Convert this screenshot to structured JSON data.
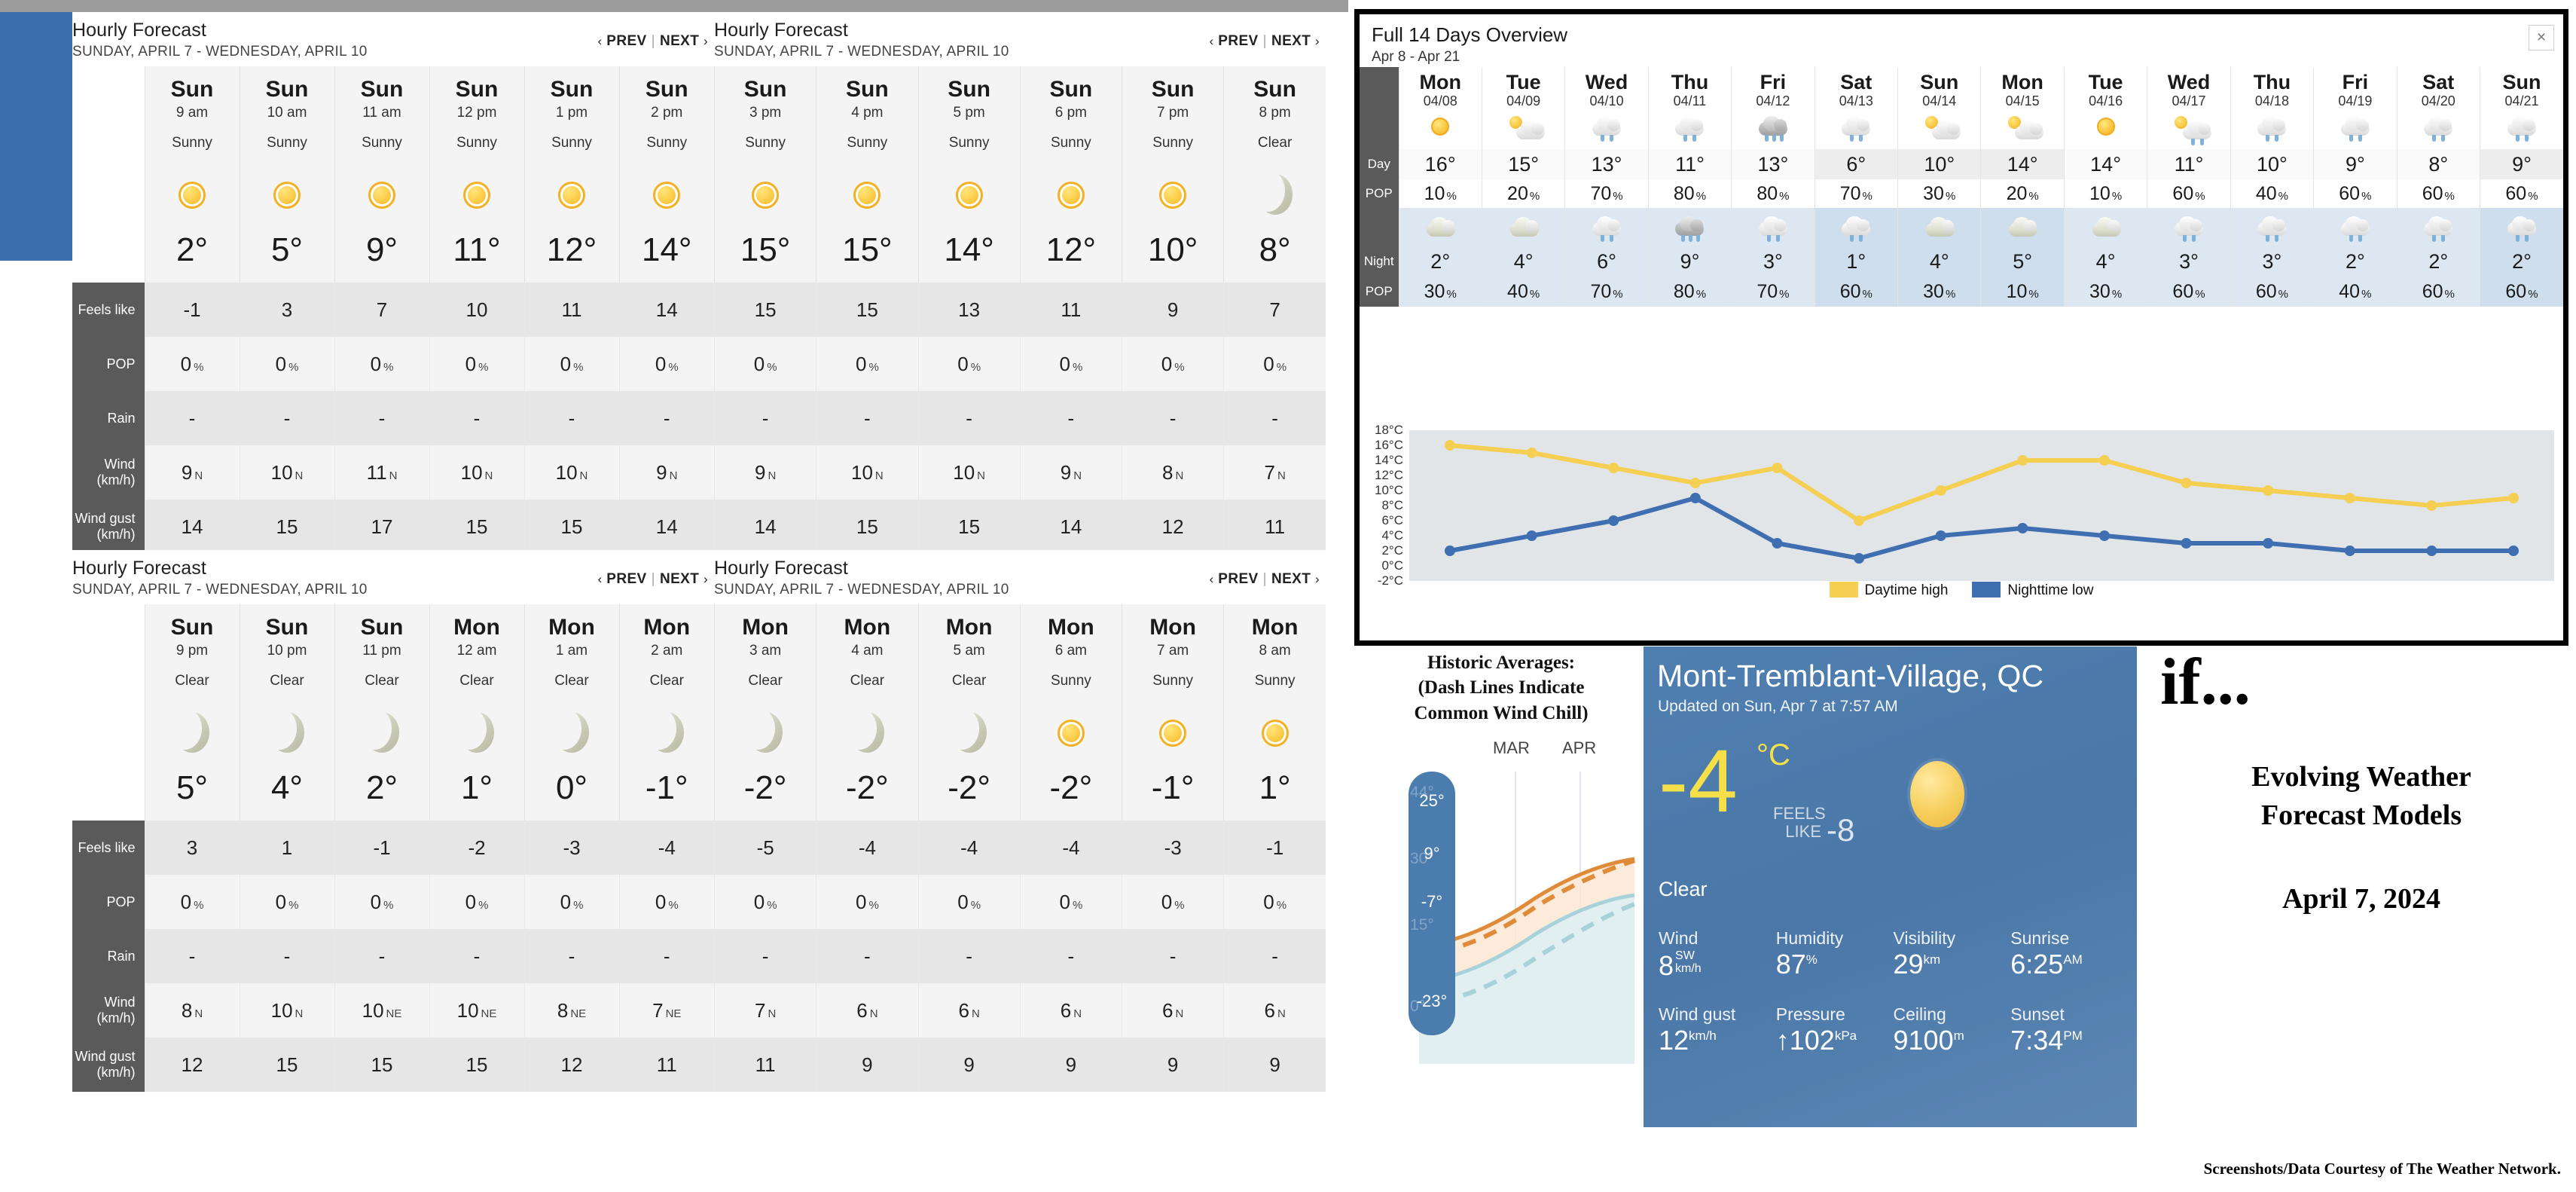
{
  "hourly_panels": [
    {
      "id": "hourly-1",
      "title": "Hourly Forecast",
      "subtitle": "SUNDAY, APRIL 7 - WEDNESDAY, APRIL 10",
      "prev_label": "PREV",
      "next_label": "NEXT",
      "row_labels": {
        "feels_like": "Feels like",
        "pop": "POP",
        "rain": "Rain",
        "wind": "Wind",
        "wind_unit": "(km/h)",
        "wind_gust": "Wind gust",
        "wind_gust_unit": "(km/h)"
      },
      "columns": [
        {
          "dow": "Sun",
          "hour": "9 am",
          "cond": "Sunny",
          "icon": "sun-icon",
          "temp": "2°",
          "feels": "-1",
          "pop": "0",
          "rain": "-",
          "wind": "9",
          "wind_dir": "N",
          "gust": "14"
        },
        {
          "dow": "Sun",
          "hour": "10 am",
          "cond": "Sunny",
          "icon": "sun-icon",
          "temp": "5°",
          "feels": "3",
          "pop": "0",
          "rain": "-",
          "wind": "10",
          "wind_dir": "N",
          "gust": "15"
        },
        {
          "dow": "Sun",
          "hour": "11 am",
          "cond": "Sunny",
          "icon": "sun-icon",
          "temp": "9°",
          "feels": "7",
          "pop": "0",
          "rain": "-",
          "wind": "11",
          "wind_dir": "N",
          "gust": "17"
        },
        {
          "dow": "Sun",
          "hour": "12 pm",
          "cond": "Sunny",
          "icon": "sun-icon",
          "temp": "11°",
          "feels": "10",
          "pop": "0",
          "rain": "-",
          "wind": "10",
          "wind_dir": "N",
          "gust": "15"
        },
        {
          "dow": "Sun",
          "hour": "1 pm",
          "cond": "Sunny",
          "icon": "sun-icon",
          "temp": "12°",
          "feels": "11",
          "pop": "0",
          "rain": "-",
          "wind": "10",
          "wind_dir": "N",
          "gust": "15"
        },
        {
          "dow": "Sun",
          "hour": "2 pm",
          "cond": "Sunny",
          "icon": "sun-icon",
          "temp": "14°",
          "feels": "14",
          "pop": "0",
          "rain": "-",
          "wind": "9",
          "wind_dir": "N",
          "gust": "14"
        }
      ]
    },
    {
      "id": "hourly-2",
      "title": "Hourly Forecast",
      "subtitle": "SUNDAY, APRIL 7 - WEDNESDAY, APRIL 10",
      "prev_label": "PREV",
      "next_label": "NEXT",
      "columns": [
        {
          "dow": "Sun",
          "hour": "3 pm",
          "cond": "Sunny",
          "icon": "sun-icon",
          "temp": "15°",
          "feels": "15",
          "pop": "0",
          "rain": "-",
          "wind": "9",
          "wind_dir": "N",
          "gust": "14"
        },
        {
          "dow": "Sun",
          "hour": "4 pm",
          "cond": "Sunny",
          "icon": "sun-icon",
          "temp": "15°",
          "feels": "15",
          "pop": "0",
          "rain": "-",
          "wind": "10",
          "wind_dir": "N",
          "gust": "15"
        },
        {
          "dow": "Sun",
          "hour": "5 pm",
          "cond": "Sunny",
          "icon": "sun-icon",
          "temp": "14°",
          "feels": "13",
          "pop": "0",
          "rain": "-",
          "wind": "10",
          "wind_dir": "N",
          "gust": "15"
        },
        {
          "dow": "Sun",
          "hour": "6 pm",
          "cond": "Sunny",
          "icon": "sun-icon",
          "temp": "12°",
          "feels": "11",
          "pop": "0",
          "rain": "-",
          "wind": "9",
          "wind_dir": "N",
          "gust": "14"
        },
        {
          "dow": "Sun",
          "hour": "7 pm",
          "cond": "Sunny",
          "icon": "sun-icon",
          "temp": "10°",
          "feels": "9",
          "pop": "0",
          "rain": "-",
          "wind": "8",
          "wind_dir": "N",
          "gust": "12"
        },
        {
          "dow": "Sun",
          "hour": "8 pm",
          "cond": "Clear",
          "icon": "moon-icon",
          "temp": "8°",
          "feels": "7",
          "pop": "0",
          "rain": "-",
          "wind": "7",
          "wind_dir": "N",
          "gust": "11"
        }
      ]
    },
    {
      "id": "hourly-3",
      "title": "Hourly Forecast",
      "subtitle": "SUNDAY, APRIL 7 - WEDNESDAY, APRIL 10",
      "prev_label": "PREV",
      "next_label": "NEXT",
      "columns": [
        {
          "dow": "Sun",
          "hour": "9 pm",
          "cond": "Clear",
          "icon": "moon-icon",
          "temp": "5°",
          "feels": "3",
          "pop": "0",
          "rain": "-",
          "wind": "8",
          "wind_dir": "N",
          "gust": "12"
        },
        {
          "dow": "Sun",
          "hour": "10 pm",
          "cond": "Clear",
          "icon": "moon-icon",
          "temp": "4°",
          "feels": "1",
          "pop": "0",
          "rain": "-",
          "wind": "10",
          "wind_dir": "N",
          "gust": "15"
        },
        {
          "dow": "Sun",
          "hour": "11 pm",
          "cond": "Clear",
          "icon": "moon-icon",
          "temp": "2°",
          "feels": "-1",
          "pop": "0",
          "rain": "-",
          "wind": "10",
          "wind_dir": "NE",
          "gust": "15"
        },
        {
          "dow": "Mon",
          "hour": "12 am",
          "cond": "Clear",
          "icon": "moon-icon",
          "temp": "1°",
          "feels": "-2",
          "pop": "0",
          "rain": "-",
          "wind": "10",
          "wind_dir": "NE",
          "gust": "15"
        },
        {
          "dow": "Mon",
          "hour": "1 am",
          "cond": "Clear",
          "icon": "moon-icon",
          "temp": "0°",
          "feels": "-3",
          "pop": "0",
          "rain": "-",
          "wind": "8",
          "wind_dir": "NE",
          "gust": "12"
        },
        {
          "dow": "Mon",
          "hour": "2 am",
          "cond": "Clear",
          "icon": "moon-icon",
          "temp": "-1°",
          "feels": "-4",
          "pop": "0",
          "rain": "-",
          "wind": "7",
          "wind_dir": "NE",
          "gust": "11"
        }
      ]
    },
    {
      "id": "hourly-4",
      "title": "Hourly Forecast",
      "subtitle": "SUNDAY, APRIL 7 - WEDNESDAY, APRIL 10",
      "prev_label": "PREV",
      "next_label": "NEXT",
      "columns": [
        {
          "dow": "Mon",
          "hour": "3 am",
          "cond": "Clear",
          "icon": "moon-icon",
          "temp": "-2°",
          "feels": "-5",
          "pop": "0",
          "rain": "-",
          "wind": "7",
          "wind_dir": "N",
          "gust": "11"
        },
        {
          "dow": "Mon",
          "hour": "4 am",
          "cond": "Clear",
          "icon": "moon-icon",
          "temp": "-2°",
          "feels": "-4",
          "pop": "0",
          "rain": "-",
          "wind": "6",
          "wind_dir": "N",
          "gust": "9"
        },
        {
          "dow": "Mon",
          "hour": "5 am",
          "cond": "Clear",
          "icon": "moon-icon",
          "temp": "-2°",
          "feels": "-4",
          "pop": "0",
          "rain": "-",
          "wind": "6",
          "wind_dir": "N",
          "gust": "9"
        },
        {
          "dow": "Mon",
          "hour": "6 am",
          "cond": "Sunny",
          "icon": "sun-icon",
          "temp": "-2°",
          "feels": "-4",
          "pop": "0",
          "rain": "-",
          "wind": "6",
          "wind_dir": "N",
          "gust": "9"
        },
        {
          "dow": "Mon",
          "hour": "7 am",
          "cond": "Sunny",
          "icon": "sun-icon",
          "temp": "-1°",
          "feels": "-3",
          "pop": "0",
          "rain": "-",
          "wind": "6",
          "wind_dir": "N",
          "gust": "9"
        },
        {
          "dow": "Mon",
          "hour": "8 am",
          "cond": "Sunny",
          "icon": "sun-icon",
          "temp": "1°",
          "feels": "-1",
          "pop": "0",
          "rain": "-",
          "wind": "6",
          "wind_dir": "N",
          "gust": "9"
        }
      ]
    }
  ],
  "overview": {
    "title": "Full 14 Days Overview",
    "subtitle": "Apr 8 - Apr 21",
    "close_label": "×",
    "row_labels": {
      "day": "Day",
      "pop1": "POP",
      "night": "Night",
      "pop2": "POP"
    },
    "days": [
      {
        "dow": "Mon",
        "date": "04/08",
        "day_icon": "sun-icon",
        "day_temp": "16°",
        "day_pop": "10",
        "night_icon": "partly-cloudy-night-icon",
        "night_temp": "2°",
        "night_pop": "30"
      },
      {
        "dow": "Tue",
        "date": "04/09",
        "day_icon": "partly-cloudy-icon",
        "day_temp": "15°",
        "day_pop": "20",
        "night_icon": "partly-cloudy-night-icon",
        "night_temp": "4°",
        "night_pop": "40"
      },
      {
        "dow": "Wed",
        "date": "04/10",
        "day_icon": "rain-icon",
        "day_temp": "13°",
        "day_pop": "70",
        "night_icon": "rain-icon",
        "night_temp": "6°",
        "night_pop": "70"
      },
      {
        "dow": "Thu",
        "date": "04/11",
        "day_icon": "rain-icon",
        "day_temp": "11°",
        "day_pop": "80",
        "night_icon": "heavy-rain-icon",
        "night_temp": "9°",
        "night_pop": "80"
      },
      {
        "dow": "Fri",
        "date": "04/12",
        "day_icon": "heavy-rain-icon",
        "day_temp": "13°",
        "day_pop": "80",
        "night_icon": "rain-icon",
        "night_temp": "3°",
        "night_pop": "70"
      },
      {
        "dow": "Sat",
        "date": "04/13",
        "day_icon": "rain-icon",
        "day_temp": "6°",
        "day_pop": "70",
        "night_icon": "rain-icon",
        "night_temp": "1°",
        "night_pop": "60"
      },
      {
        "dow": "Sun",
        "date": "04/14",
        "day_icon": "partly-cloudy-icon",
        "day_temp": "10°",
        "day_pop": "30",
        "night_icon": "partly-cloudy-night-icon",
        "night_temp": "4°",
        "night_pop": "30"
      },
      {
        "dow": "Mon",
        "date": "04/15",
        "day_icon": "partly-cloudy-icon",
        "day_temp": "14°",
        "day_pop": "20",
        "night_icon": "partly-cloudy-night-icon",
        "night_temp": "5°",
        "night_pop": "10"
      },
      {
        "dow": "Tue",
        "date": "04/16",
        "day_icon": "sun-icon",
        "day_temp": "14°",
        "day_pop": "10",
        "night_icon": "partly-cloudy-night-icon",
        "night_temp": "4°",
        "night_pop": "30"
      },
      {
        "dow": "Wed",
        "date": "04/17",
        "day_icon": "sun-shower-icon",
        "day_temp": "11°",
        "day_pop": "60",
        "night_icon": "rain-icon",
        "night_temp": "3°",
        "night_pop": "60"
      },
      {
        "dow": "Thu",
        "date": "04/18",
        "day_icon": "rain-icon",
        "day_temp": "10°",
        "day_pop": "40",
        "night_icon": "rain-icon",
        "night_temp": "3°",
        "night_pop": "60"
      },
      {
        "dow": "Fri",
        "date": "04/19",
        "day_icon": "rain-icon",
        "day_temp": "9°",
        "day_pop": "60",
        "night_icon": "rain-icon",
        "night_temp": "2°",
        "night_pop": "40"
      },
      {
        "dow": "Sat",
        "date": "04/20",
        "day_icon": "rain-icon",
        "day_temp": "8°",
        "day_pop": "60",
        "night_icon": "rain-icon",
        "night_temp": "2°",
        "night_pop": "60"
      },
      {
        "dow": "Sun",
        "date": "04/21",
        "day_icon": "rain-icon",
        "day_temp": "9°",
        "day_pop": "60",
        "night_icon": "rain-icon",
        "night_temp": "2°",
        "night_pop": "60"
      }
    ]
  },
  "chart_data": {
    "type": "line",
    "title": "",
    "xlabel": "",
    "ylabel": "",
    "ylim": [
      -2,
      18
    ],
    "yticks": [
      "18°C",
      "16°C",
      "14°C",
      "12°C",
      "10°C",
      "8°C",
      "6°C",
      "4°C",
      "2°C",
      "0°C",
      "-2°C"
    ],
    "ytick_values": [
      18,
      16,
      14,
      12,
      10,
      8,
      6,
      4,
      2,
      0,
      -2
    ],
    "grid": false,
    "legend_position": "bottom",
    "categories": [
      "04/08",
      "04/09",
      "04/10",
      "04/11",
      "04/12",
      "04/13",
      "04/14",
      "04/15",
      "04/16",
      "04/17",
      "04/18",
      "04/19",
      "04/20",
      "04/21"
    ],
    "series": [
      {
        "name": "Daytime high",
        "color": "#f5cf52",
        "values": [
          16,
          15,
          13,
          11,
          13,
          6,
          10,
          14,
          14,
          11,
          10,
          9,
          8,
          9
        ]
      },
      {
        "name": "Nighttime low",
        "color": "#3f6fb0",
        "values": [
          2,
          4,
          6,
          9,
          3,
          1,
          4,
          5,
          4,
          3,
          3,
          2,
          2,
          2
        ]
      }
    ]
  },
  "historic": {
    "title_line1": "Historic Averages:",
    "title_line2": "(Dash Lines Indicate",
    "title_line3": "Common Wind Chill)",
    "months": [
      "MAR",
      "APR"
    ],
    "scale_labels": [
      "25°",
      "9°",
      "-7°",
      "-23°"
    ],
    "ghost_labels": [
      "44°",
      "30°",
      "15°",
      "0°"
    ]
  },
  "current": {
    "city": "Mont-Tremblant-Village, QC",
    "updated": "Updated on Sun, Apr 7 at 7:57 AM",
    "temp": "-4",
    "unit": "°C",
    "feels_like_label_1": "FEELS",
    "feels_like_label_2": "LIKE",
    "feels_like_value": "-8",
    "condition": "Clear",
    "icon": "sun-icon",
    "stats": [
      {
        "label": "Wind",
        "value": "8",
        "sup": "SW",
        "sub": "km/h",
        "stacked": true
      },
      {
        "label": "Humidity",
        "value": "87",
        "sup": "%",
        "stacked": false
      },
      {
        "label": "Visibility",
        "value": "29",
        "sup": "km",
        "stacked": false
      },
      {
        "label": "Sunrise",
        "value": "6:25",
        "sup": "AM",
        "stacked": false
      },
      {
        "label": "Wind gust",
        "value": "12",
        "sup": "km/h",
        "stacked": false
      },
      {
        "label": "Pressure",
        "value": "↑102",
        "sup": "kPa",
        "stacked": false
      },
      {
        "label": "Ceiling",
        "value": "9100",
        "sup": "m",
        "stacked": false
      },
      {
        "label": "Sunset",
        "value": "7:34",
        "sup": "PM",
        "stacked": false
      }
    ]
  },
  "title_block": {
    "if": "if...",
    "heading_line1": "Evolving Weather",
    "heading_line2": "Forecast Models",
    "date": "April 7, 2024"
  },
  "credit": "Screenshots/Data Courtesy of The Weather Network."
}
